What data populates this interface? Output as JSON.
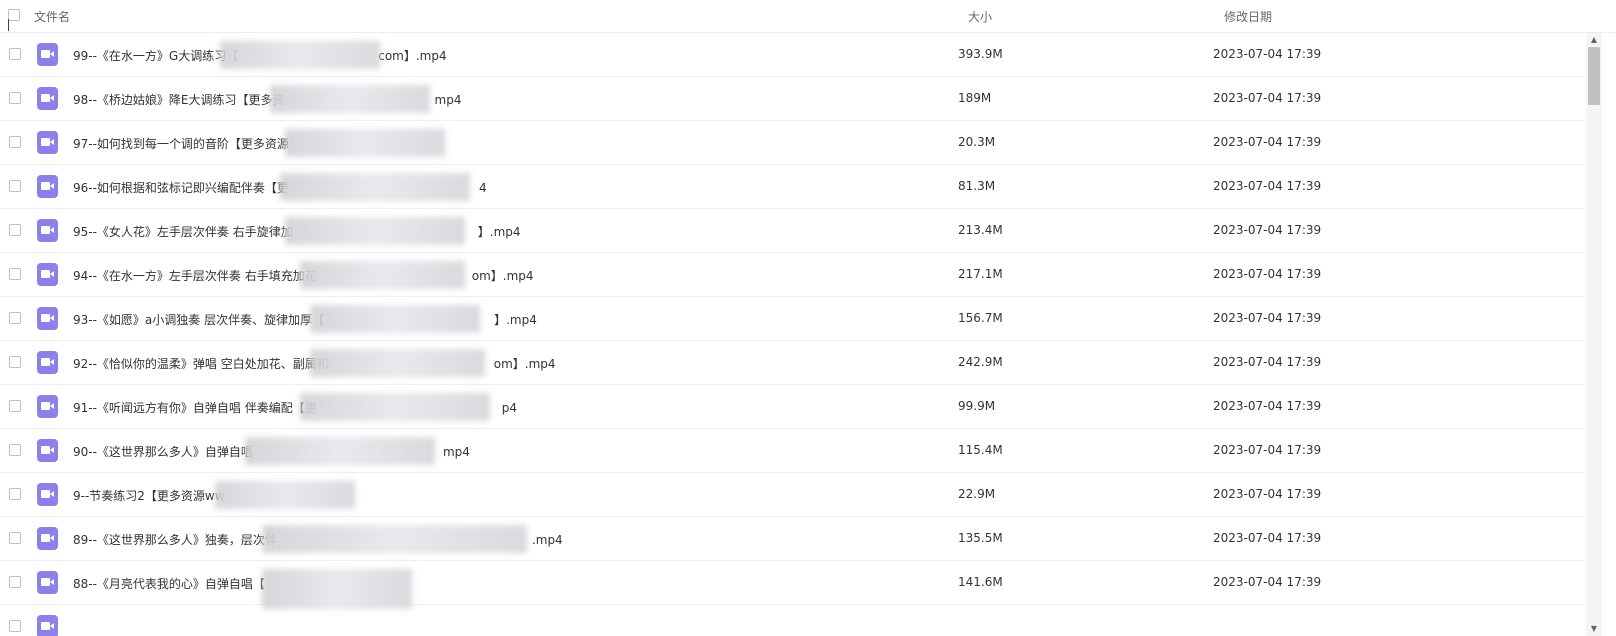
{
  "header": {
    "name_label": "文件名",
    "size_label": "大小",
    "date_label": "修改日期"
  },
  "files": [
    {
      "name": "99--《在水一方》G大调练习【",
      "name_tail": "com】.mp4",
      "size": "393.9M",
      "date": "2023-07-04 17:39"
    },
    {
      "name": "98--《桥边姑娘》降E大调练习【更多资",
      "name_tail": "mp4",
      "size": "189M",
      "date": "2023-07-04 17:39"
    },
    {
      "name": "97--如何找到每一个调的音阶【更多资源",
      "name_tail": "",
      "size": "20.3M",
      "date": "2023-07-04 17:39"
    },
    {
      "name": "96--如何根据和弦标记即兴编配伴奏【更",
      "name_tail": "4",
      "size": "81.3M",
      "date": "2023-07-04 17:39"
    },
    {
      "name": "95--《女人花》左手层次伴奏 右手旋律加",
      "name_tail": "】.mp4",
      "size": "213.4M",
      "date": "2023-07-04 17:39"
    },
    {
      "name": "94--《在水一方》左手层次伴奏 右手填充加花",
      "name_tail": "om】.mp4",
      "size": "217.1M",
      "date": "2023-07-04 17:39"
    },
    {
      "name": "93--《如愿》a小调独奏 层次伴奏、旋律加厚【",
      "name_tail": "】.mp4",
      "size": "156.7M",
      "date": "2023-07-04 17:39"
    },
    {
      "name": "92--《恰似你的温柔》弹唱 空白处加花、副属和",
      "name_tail": "om】.mp4",
      "size": "242.9M",
      "date": "2023-07-04 17:39"
    },
    {
      "name": "91--《听闻远方有你》自弹自唱 伴奏编配【更",
      "name_tail": "p4",
      "size": "99.9M",
      "date": "2023-07-04 17:39"
    },
    {
      "name": "90--《这世界那么多人》自弹自唱",
      "name_tail": "mp4",
      "size": "115.4M",
      "date": "2023-07-04 17:39"
    },
    {
      "name": "9--节奏练习2【更多资源ww",
      "name_tail": "",
      "size": "22.9M",
      "date": "2023-07-04 17:39"
    },
    {
      "name": "89--《这世界那么多人》独奏，层次伴",
      "name_tail": ".mp4",
      "size": "135.5M",
      "date": "2023-07-04 17:39"
    },
    {
      "name": "88--《月亮代表我的心》自弹自唱【",
      "name_tail": "",
      "size": "141.6M",
      "date": "2023-07-04 17:39"
    },
    {
      "name": "",
      "name_tail": "",
      "size": "",
      "date": ""
    }
  ],
  "icons": {
    "file": "video-file-icon",
    "scroll_up": "scroll-up-arrow-icon",
    "scroll_down": "scroll-down-arrow-icon"
  },
  "colors": {
    "video_icon": "#8a82ea",
    "row_divider": "#f0f0f0"
  }
}
